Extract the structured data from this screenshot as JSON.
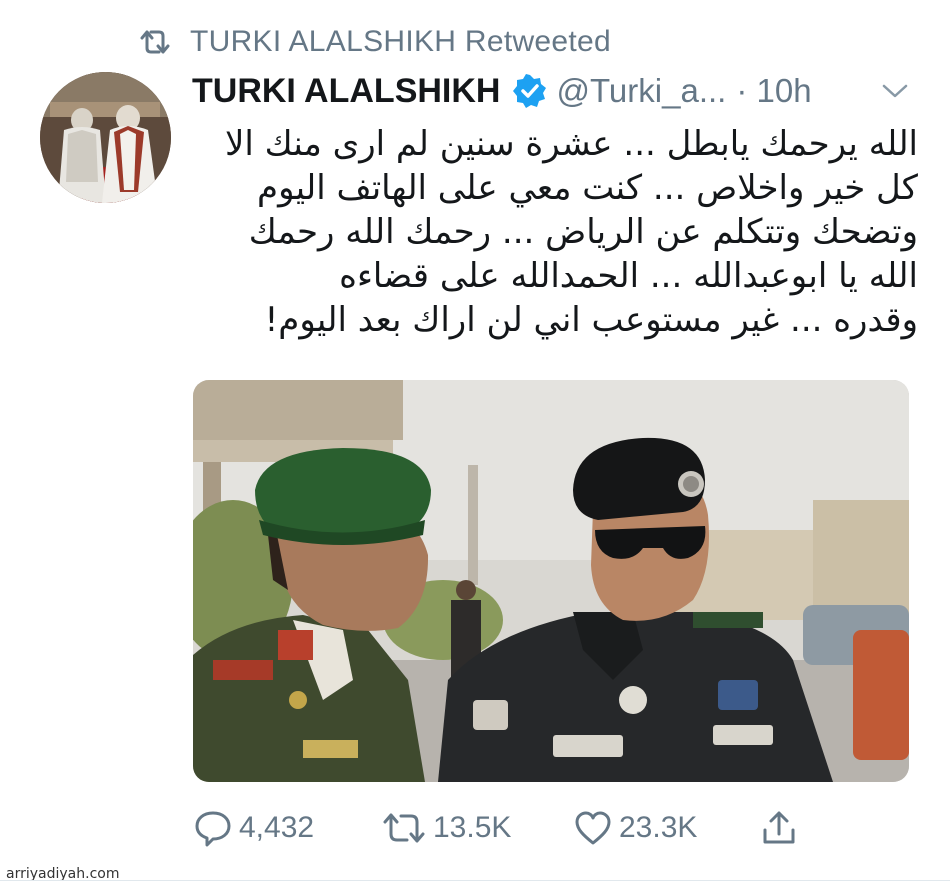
{
  "retweet": {
    "text": "TURKI ALALSHIKH Retweeted",
    "icon": "retweet-icon"
  },
  "tweet": {
    "author_name": "TURKI ALALSHIKH",
    "handle": "@Turki_a...",
    "time": "· 10h",
    "verified_color": "#1da1f2",
    "text_lines": [
      "الله يرحمك يابطل ... عشرة سنين لم ارى منك الا",
      "كل خير واخلاص ... كنت معي على الهاتف اليوم",
      "وتضحك وتتكلم عن الرياض ... رحمك الله رحمك",
      "الله يا ابوعبدالله ... الحمدالله على قضاءه",
      "وقدره ... غير مستوعب اني لن اراك بعد اليوم!"
    ]
  },
  "actions": {
    "replies": "4,432",
    "retweets": "13.5K",
    "likes": "23.3K"
  },
  "watermark": "arriyadiyah.com",
  "colors": {
    "secondary_text": "#657786",
    "primary_text": "#14171a",
    "accent": "#1da1f2"
  }
}
